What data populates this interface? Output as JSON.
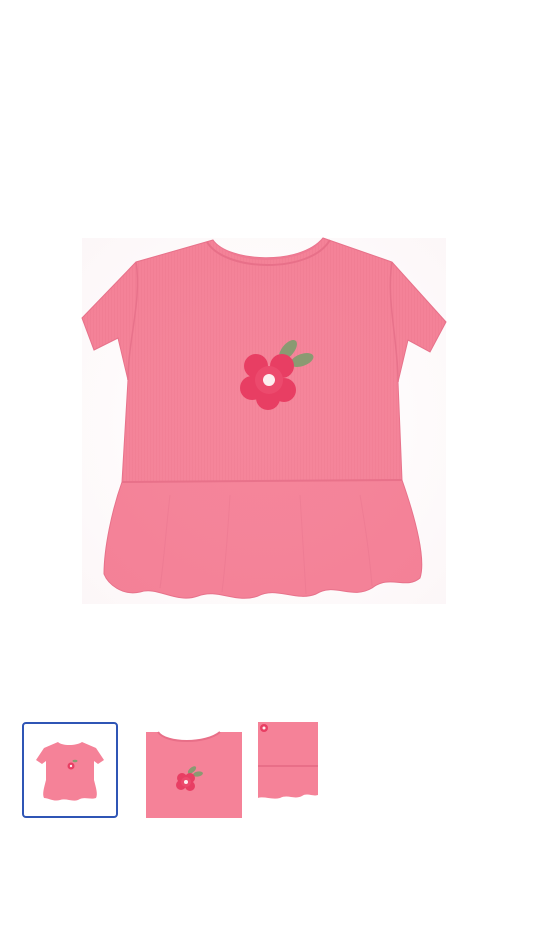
{
  "product": {
    "image_name": "pink-peplum-ribbed-tee-with-flower",
    "main_color": "#f58298",
    "flower_color": "#e83e63",
    "leaf_color": "#8a9a72"
  },
  "gallery": {
    "thumbnails": [
      {
        "name": "thumbnail-front",
        "selected": true
      },
      {
        "name": "thumbnail-detail-flower",
        "selected": false
      },
      {
        "name": "thumbnail-detail-hem",
        "selected": false
      }
    ],
    "selected_border_color": "#2f55b5"
  }
}
